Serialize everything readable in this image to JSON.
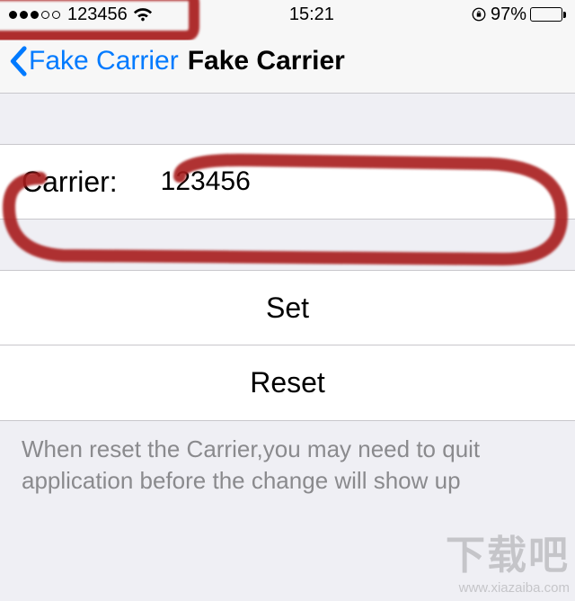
{
  "statusBar": {
    "carrier": "123456",
    "time": "15:21",
    "batteryPercent": "97%"
  },
  "nav": {
    "backLabel": "Fake Carrier",
    "title": "Fake Carrier"
  },
  "carrierField": {
    "label": "Carrier:",
    "value": "123456"
  },
  "buttons": {
    "set": "Set",
    "reset": "Reset"
  },
  "footer": "When reset the Carrier,you may need to quit application before the change will show up",
  "watermark": {
    "main": "下载吧",
    "sub": "www.xiazaiba.com"
  }
}
